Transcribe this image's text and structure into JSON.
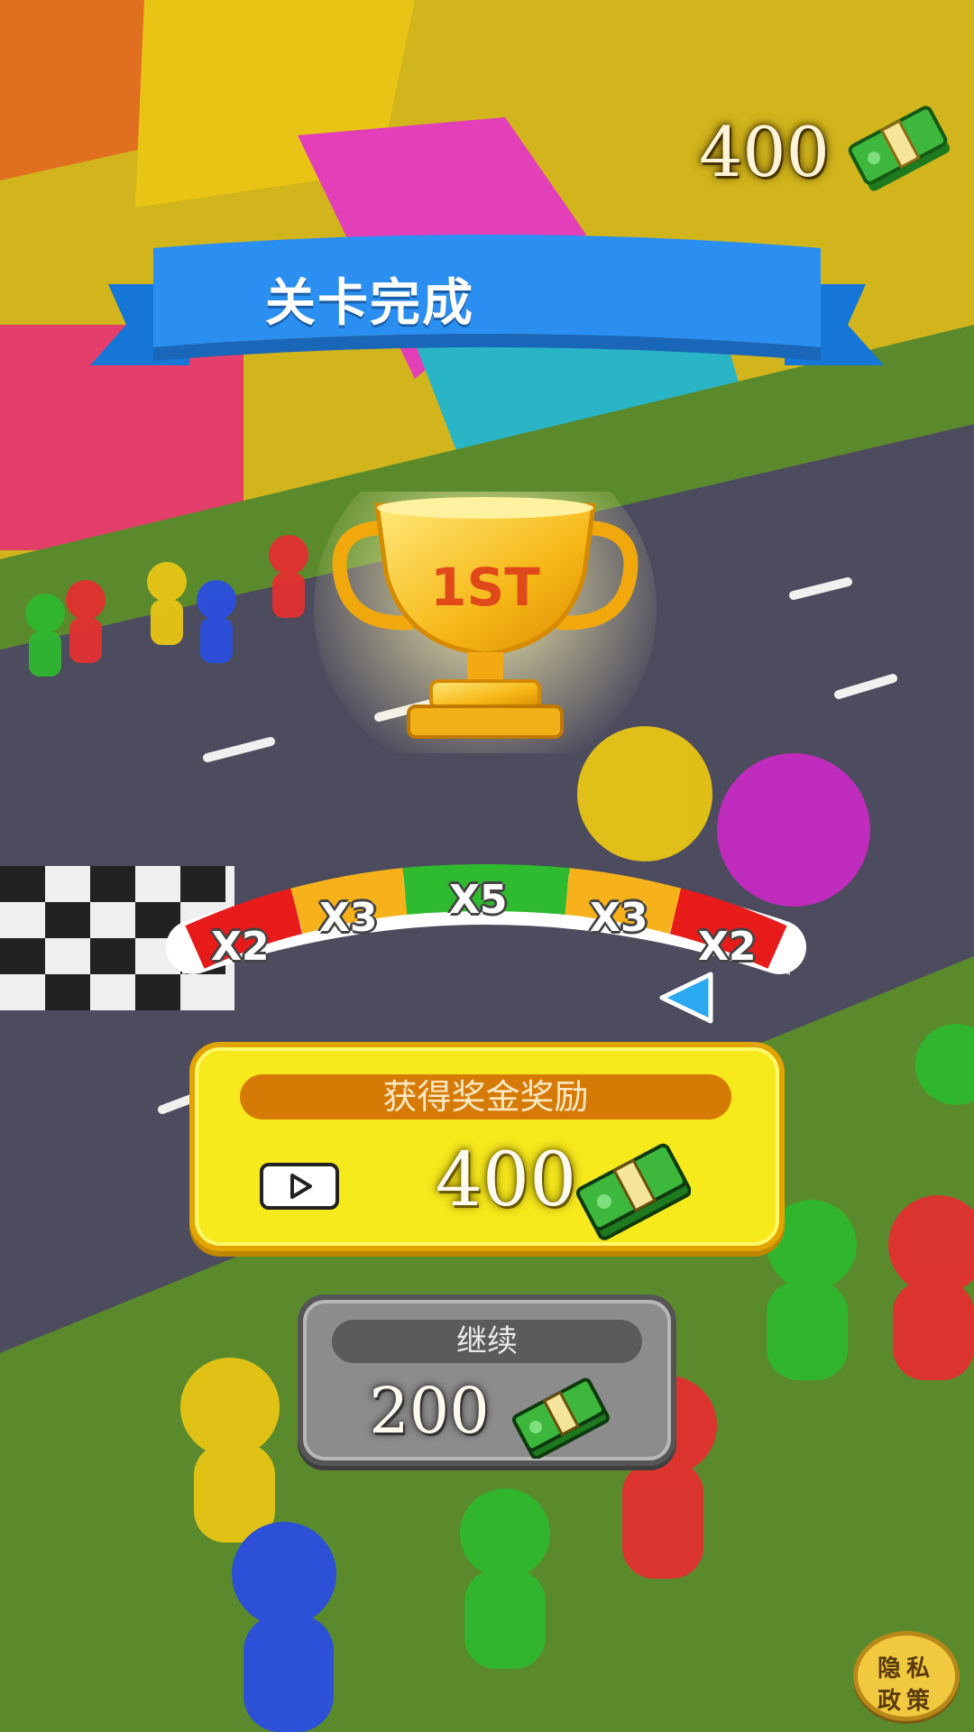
{
  "header": {
    "coins": "400",
    "coin_icon": "cash-stack-icon"
  },
  "banner": {
    "title": "关卡完成"
  },
  "trophy": {
    "rank": "1ST"
  },
  "multiplier_meter": {
    "segments": [
      {
        "label": "X2",
        "color": "#e81b1b"
      },
      {
        "label": "X3",
        "color": "#f7b21b"
      },
      {
        "label": "X5",
        "color": "#2fbb2f"
      },
      {
        "label": "X3",
        "color": "#f7b21b"
      },
      {
        "label": "X2",
        "color": "#e81b1b"
      }
    ],
    "pointer_icon": "triangle-pointer-icon"
  },
  "reward": {
    "title": "获得奖金奖励",
    "amount": "400",
    "video_icon": "play-video-icon"
  },
  "continue": {
    "title": "继续",
    "amount": "200"
  },
  "privacy": {
    "line1": "隐私",
    "line2": "政策"
  }
}
